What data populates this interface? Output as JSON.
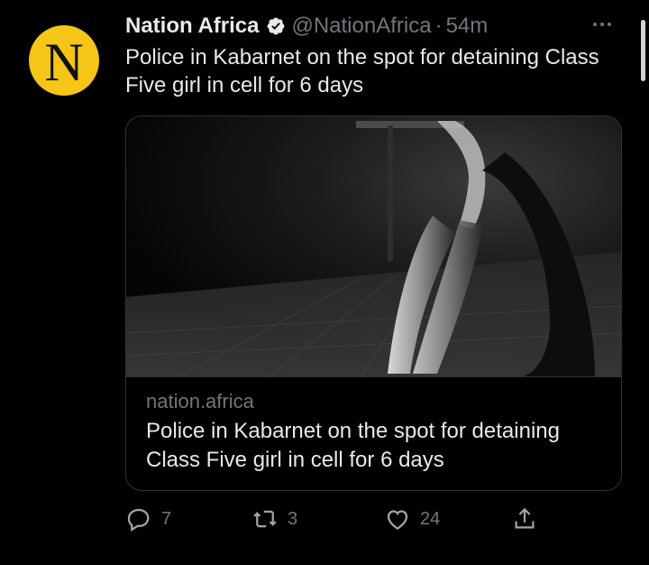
{
  "author": {
    "name": "Nation Africa",
    "handle": "@NationAfrica",
    "separator": "·",
    "time": "54m",
    "avatar_letter": "N",
    "avatar_color": "#f5c518"
  },
  "tweet": {
    "text": "Police in Kabarnet on the spot for detaining Class Five girl in cell for 6 days"
  },
  "card": {
    "domain": "nation.africa",
    "title": "Police in Kabarnet on the spot for detaining Class Five girl in cell for 6 days"
  },
  "actions": {
    "replies": "7",
    "retweets": "3",
    "likes": "24"
  },
  "icons": [
    "verified-badge-icon",
    "more-icon",
    "reply-icon",
    "retweet-icon",
    "like-icon",
    "share-icon"
  ]
}
